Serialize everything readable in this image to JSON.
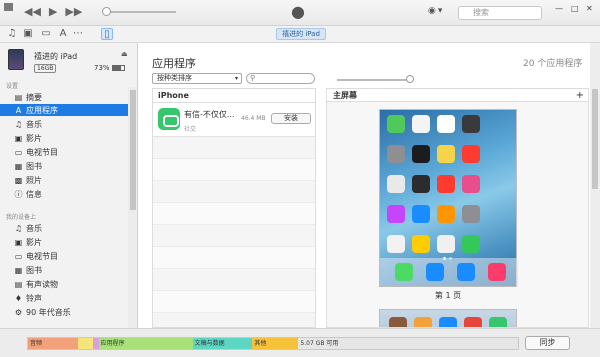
{
  "colors": {
    "selection": "#1e7be4",
    "accent": "#2a74c9",
    "wechat_green": "#36c66b"
  },
  "titlebar": {
    "search_placeholder": "搜索",
    "transport_icons": [
      "previous-icon",
      "play-icon",
      "next-icon"
    ]
  },
  "toolbar": {
    "device_tab": "禧进的 iPad"
  },
  "device": {
    "name": "禧进的 iPad",
    "capacity": "16GB",
    "battery": "73%"
  },
  "sidebar": {
    "settings_label": "设置",
    "settings_items": [
      {
        "label": "摘要",
        "icon": "summary-icon"
      },
      {
        "label": "应用程序",
        "icon": "apps-icon"
      },
      {
        "label": "音乐",
        "icon": "music-icon"
      },
      {
        "label": "影片",
        "icon": "movies-icon"
      },
      {
        "label": "电视节目",
        "icon": "tv-icon"
      },
      {
        "label": "图书",
        "icon": "books-icon"
      },
      {
        "label": "照片",
        "icon": "photos-icon"
      },
      {
        "label": "信息",
        "icon": "info-icon"
      }
    ],
    "ondevice_label": "我的设备上",
    "ondevice_items": [
      {
        "label": "音乐",
        "icon": "music-icon"
      },
      {
        "label": "影片",
        "icon": "movies-icon"
      },
      {
        "label": "电视节目",
        "icon": "tv-icon"
      },
      {
        "label": "图书",
        "icon": "books-icon"
      },
      {
        "label": "有声读物",
        "icon": "audiobooks-icon"
      },
      {
        "label": "铃声",
        "icon": "tones-icon"
      },
      {
        "label": "90 年代音乐",
        "icon": "playlist-icon"
      }
    ]
  },
  "main": {
    "title": "应用程序",
    "app_count": "20 个应用程序",
    "sort_label": "按种类排序",
    "list_header": "iPhone",
    "apps": [
      {
        "name": "有信-不仅仅...",
        "category": "社交",
        "size": "46.4 MB",
        "button": "安装"
      }
    ],
    "home_screen_label": "主屏幕",
    "page_label": "第 1 页"
  },
  "footer": {
    "segments": [
      {
        "label": "音频",
        "color": "#f2a17b",
        "fraction": 0.102
      },
      {
        "label": "",
        "color": "#f5e47a",
        "fraction": 0.03
      },
      {
        "label": "",
        "color": "#d8a0dd",
        "fraction": 0.012
      },
      {
        "label": "应用程序",
        "color": "#a8e07a",
        "fraction": 0.192
      },
      {
        "label": "文稿与数据",
        "color": "#5ed6c4",
        "fraction": 0.122
      },
      {
        "label": "其他",
        "color": "#f6c23a",
        "fraction": 0.094
      },
      {
        "label": "5.07 GB 可用",
        "color": "#e6e6e6",
        "fraction": 0.448
      }
    ],
    "sync_label": "同步"
  }
}
